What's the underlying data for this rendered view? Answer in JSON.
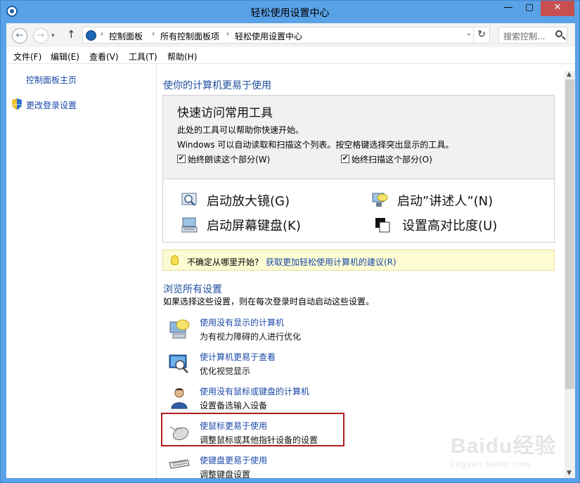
{
  "window": {
    "title": "轻松使用设置中心",
    "min_glyph": "—",
    "max_glyph": "▢",
    "close_glyph": "✕"
  },
  "nav": {
    "back_glyph": "←",
    "forward_glyph": "→",
    "forward_dropdown_glyph": "▾",
    "up_glyph": "↑",
    "breadcrumbs": [
      "控制面板",
      "所有控制面板项",
      "轻松使用设置中心"
    ],
    "crumb_sep": "›",
    "address_dropdown_glyph": "⌄",
    "refresh_glyph": "↻",
    "search_placeholder": "搜索控制..."
  },
  "menu": [
    "文件(F)",
    "编辑(E)",
    "查看(V)",
    "工具(T)",
    "帮助(H)"
  ],
  "left_pane": {
    "home_link": "控制面板主页",
    "change_login_link": "更改登录设置"
  },
  "main": {
    "help_glyph": "?",
    "section_title": "使你的计算机更易于使用",
    "quick": {
      "title": "快速访问常用工具",
      "desc1": "此处的工具可以帮助你快速开始。",
      "desc2": "Windows 可以自动读取和扫描这个列表。按空格键选择突出显示的工具。",
      "check1_label": "始终朗读这个部分(W)",
      "check2_label": "始终扫描这个部分(O)",
      "check_glyph": "✔"
    },
    "tools": {
      "magnifier": "启动放大镜(G)",
      "osk": "启动屏幕键盘(K)",
      "narrator": "启动”讲述人”(N)",
      "contrast": "设置高对比度(U)"
    },
    "tip": {
      "text": "不确定从哪里开始?",
      "link": "获取更加轻松使用计算机的建议(R)"
    },
    "browse": {
      "title": "浏览所有设置",
      "desc": "如果选择这些设置，则在每次登录时自动启动这些设置。"
    },
    "settings": [
      {
        "link": "使用没有显示的计算机",
        "desc": "为有视力障碍的人进行优化"
      },
      {
        "link": "使计算机更易于查看",
        "desc": "优化视觉显示"
      },
      {
        "link": "使用没有鼠标或键盘的计算机",
        "desc": "设置备选输入设备"
      },
      {
        "link": "使鼠标更易于使用",
        "desc": "调整鼠标或其他指针设备的设置"
      },
      {
        "link": "使键盘更易于使用",
        "desc": "调整键盘设置"
      }
    ]
  },
  "scrollbar": {
    "up_glyph": "▲",
    "down_glyph": "▼"
  },
  "watermark": {
    "text": "Baidu经验",
    "sub": "jingyan.baidu.com"
  },
  "colors": {
    "frame": "#5aa2e8",
    "link": "#1a48a8",
    "section_heading": "#1e4e9c",
    "close_button": "#c74f4f",
    "highlight_box": "#b01d1d",
    "tip_background": "#fdfbd2"
  }
}
